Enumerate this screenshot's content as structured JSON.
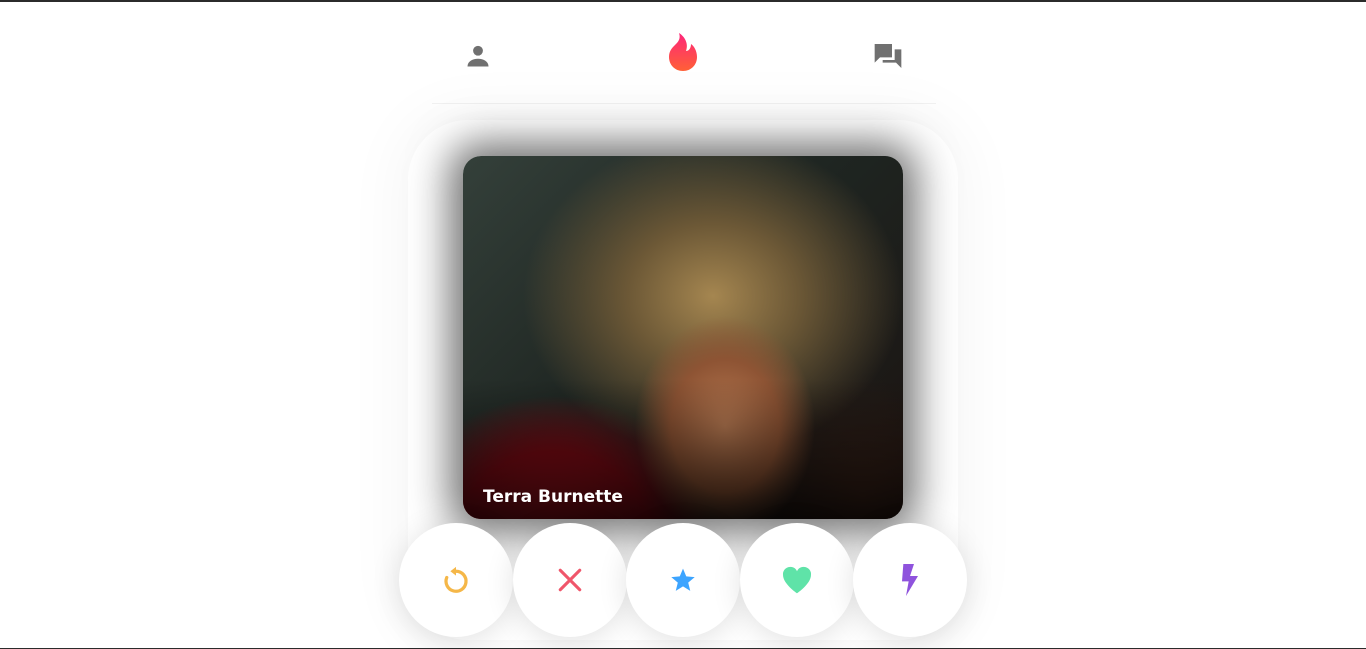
{
  "header": {
    "profile_icon": "person-icon",
    "logo_icon": "flame-icon",
    "chat_icon": "chat-bubbles-icon"
  },
  "card": {
    "name": "Terra Burnette",
    "photo_description_icon": "profile-photo"
  },
  "actions": [
    {
      "id": "rewind",
      "icon": "rewind-icon",
      "color": "#f5b748"
    },
    {
      "id": "nope",
      "icon": "close-icon",
      "color": "#f0566b"
    },
    {
      "id": "super",
      "icon": "star-icon",
      "color": "#3ca4ff"
    },
    {
      "id": "like",
      "icon": "heart-icon",
      "color": "#5fe3a8"
    },
    {
      "id": "boost",
      "icon": "bolt-icon",
      "color": "#8f53dd"
    }
  ],
  "colors": {
    "brand_gradient_start": "#fd267a",
    "brand_gradient_end": "#ff6036",
    "icon_gray": "#707070"
  }
}
